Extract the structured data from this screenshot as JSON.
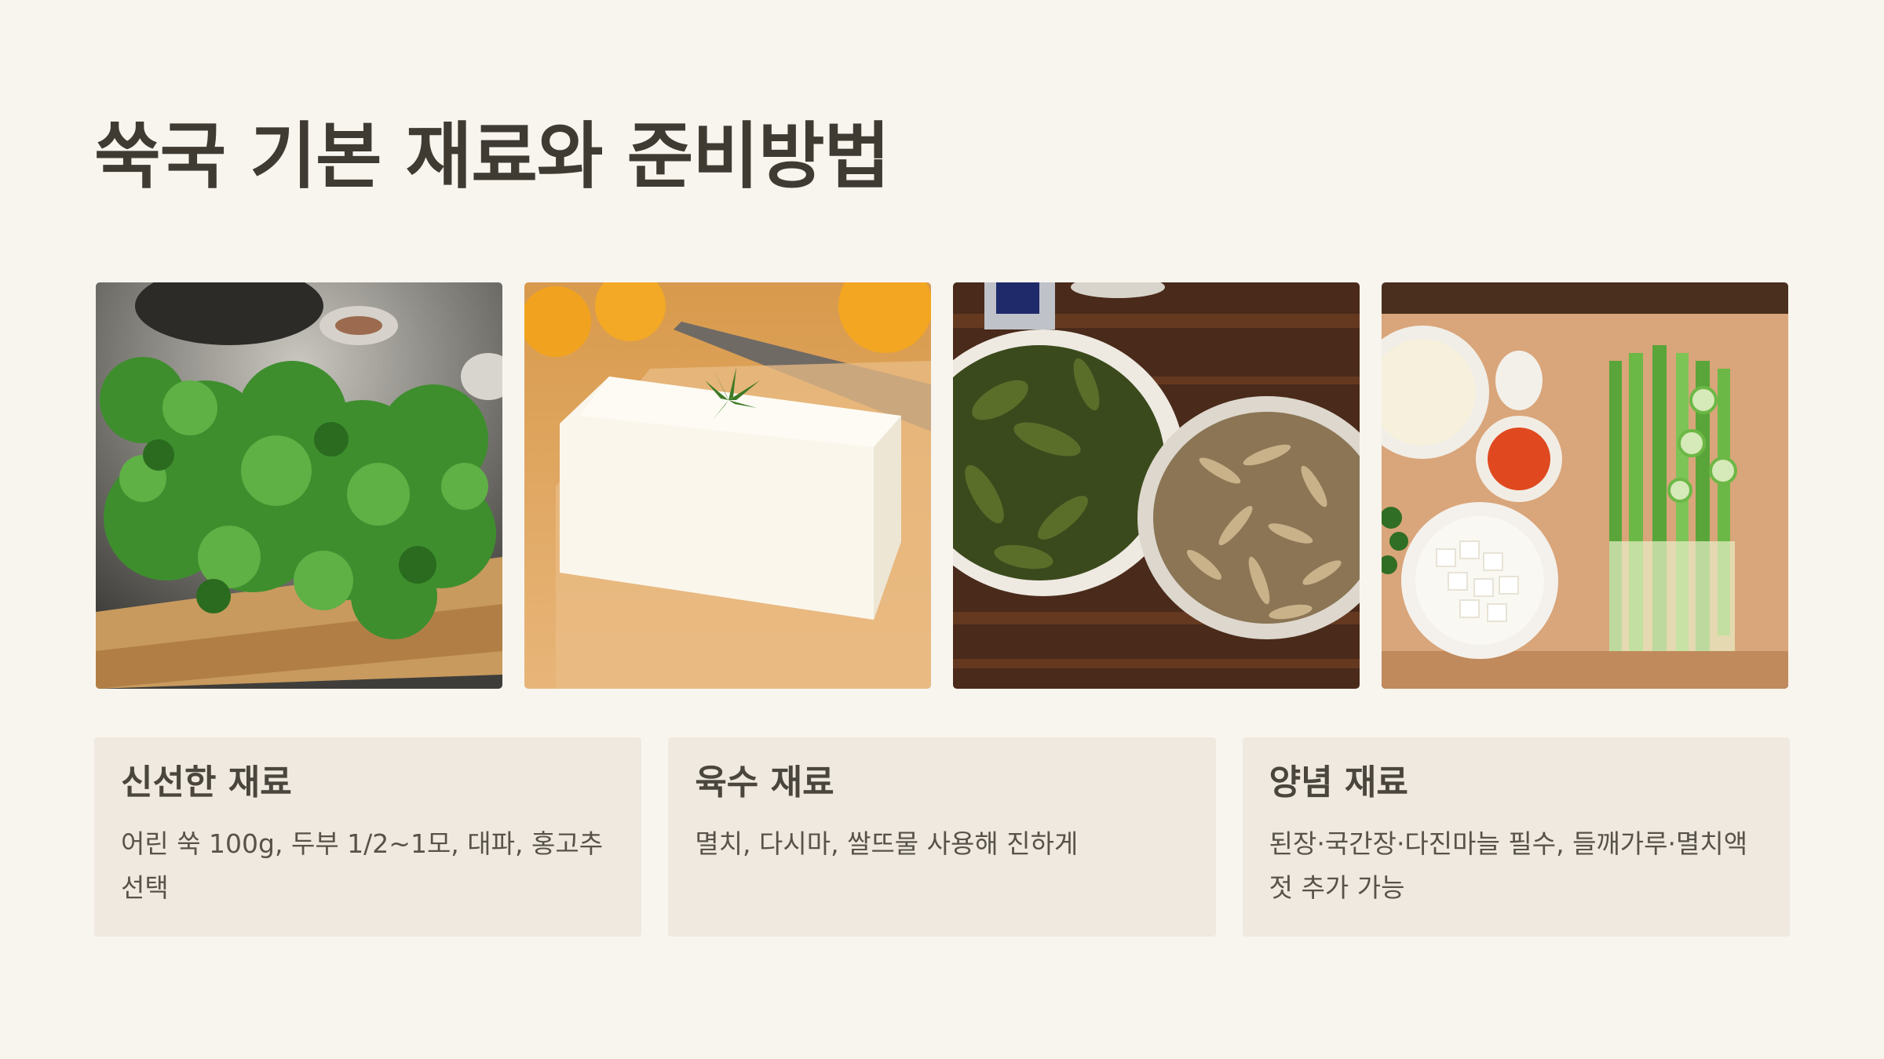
{
  "page": {
    "title": "쑥국 기본 재료와 준비방법"
  },
  "photos": [
    {
      "icon": "mugwort-greens-photo"
    },
    {
      "icon": "tofu-block-photo"
    },
    {
      "icon": "kelp-and-anchovy-photo"
    },
    {
      "icon": "seasoning-and-scallion-photo"
    }
  ],
  "cards": [
    {
      "title": "신선한 재료",
      "text": "어린 쑥 100g, 두부 1/2~1모, 대파, 홍고추 선택"
    },
    {
      "title": "육수 재료",
      "text": "멸치, 다시마, 쌀뜨물 사용해 진하게"
    },
    {
      "title": "양념 재료",
      "text": "된장·국간장·다진마늘 필수, 들깨가루·멸치액젓 추가 가능"
    }
  ],
  "colors": {
    "background": "#f8f5ef",
    "card": "#efe9df",
    "title": "#3f3b33"
  }
}
